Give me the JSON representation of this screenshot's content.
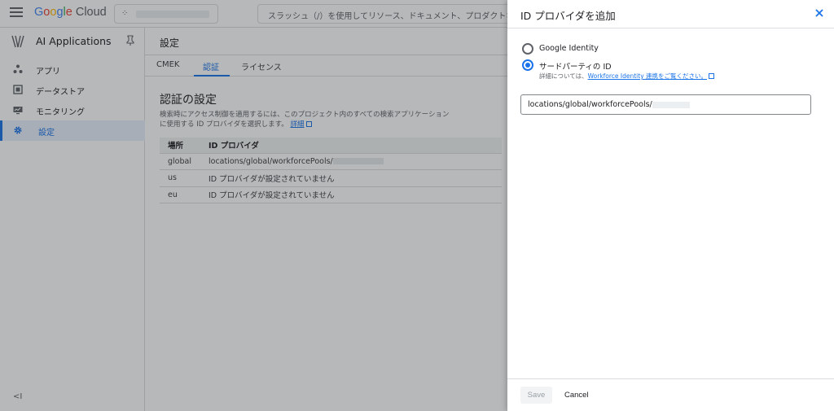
{
  "topbar": {
    "logo_parts": [
      "G",
      "o",
      "o",
      "g",
      "l",
      "e"
    ],
    "logo_cloud": "Cloud",
    "search_placeholder": "スラッシュ（/）を使用してリソース、ドキュメント、プロダクトな"
  },
  "leftnav": {
    "app_title": "AI Applications",
    "items": [
      {
        "label": "アプリ",
        "icon": "apps-icon"
      },
      {
        "label": "データストア",
        "icon": "datastore-icon"
      },
      {
        "label": "モニタリング",
        "icon": "monitoring-icon"
      },
      {
        "label": "設定",
        "icon": "gear-icon",
        "active": true
      }
    ],
    "collapse_label": "<I"
  },
  "main": {
    "title": "設定",
    "tabs": [
      {
        "label": "CMEK"
      },
      {
        "label": "認証",
        "active": true
      },
      {
        "label": "ライセンス"
      }
    ],
    "section_title": "認証の設定",
    "description_line1": "検索時にアクセス制御を適用するには、このプロジェクト内のすべての検索アプリケーション",
    "description_line2": "に使用する ID プロバイダを選択します。",
    "description_link": "詳細",
    "table": {
      "headers": [
        "場所",
        "ID プロバイダ"
      ],
      "rows": [
        [
          "global",
          "locations/global/workforcePools/"
        ],
        [
          "us",
          "ID プロバイダが設定されていません"
        ],
        [
          "eu",
          "ID プロバイダが設定されていません"
        ]
      ]
    }
  },
  "panel": {
    "title": "ID プロバイダを追加",
    "option_google": "Google Identity",
    "option_third_party": "サードパーティの ID",
    "help_prefix": "詳細については、",
    "help_link": "Workforce Identity 連携をご覧ください。",
    "pool_value": "locations/global/workforcePools/",
    "save_label": "Save",
    "cancel_label": "Cancel"
  },
  "colors": {
    "accent": "#1a73e8",
    "overlay": "rgba(32,33,36,0.32)"
  }
}
